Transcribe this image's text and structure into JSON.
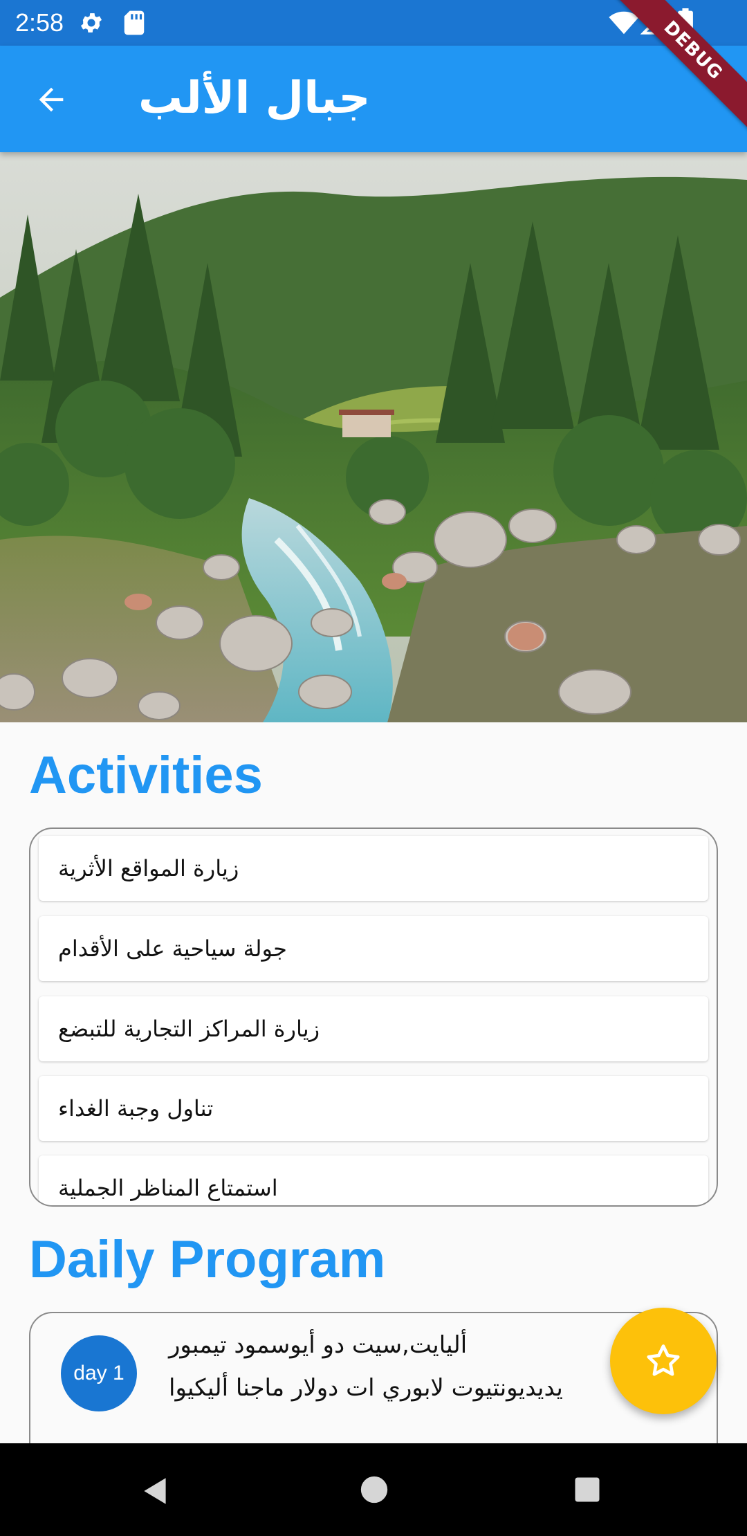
{
  "status_bar": {
    "time": "2:58",
    "icons": [
      "gear-icon",
      "sd-card-icon",
      "wifi-icon",
      "signal-icon",
      "battery-icon"
    ]
  },
  "app_bar": {
    "title": "جبال الألب",
    "back_icon": "arrow-back-icon",
    "background_color": "#2196f3"
  },
  "debug_banner": {
    "label": "DEBUG"
  },
  "hero": {
    "icon": "mountain-river-photo"
  },
  "activities": {
    "heading": "Activities",
    "items": [
      {
        "label": "زيارة المواقع الأثرية"
      },
      {
        "label": "جولة سياحية على الأقدام"
      },
      {
        "label": "زيارة المراكز التجارية للتبضع"
      },
      {
        "label": "تناول وجبة الغداء"
      },
      {
        "label": "استمتاع المناظر الجملية"
      }
    ]
  },
  "daily_program": {
    "heading": "Daily Program",
    "days": [
      {
        "badge": "day 1",
        "line1": "أليايت,سيت دو أيوسمود تيمبور",
        "line2": "يديديونتيوت لابوري ات دولار ماجنا أليكيوا"
      }
    ]
  },
  "fab": {
    "icon": "star-outline-icon",
    "color": "#fdc10a"
  },
  "nav_bar": {
    "icons": [
      "nav-back-icon",
      "nav-home-icon",
      "nav-recents-icon"
    ]
  },
  "colors": {
    "primary": "#2196f3",
    "status_bar": "#1b76d2",
    "accent": "#fdc10a",
    "day_badge": "#1976d2"
  }
}
